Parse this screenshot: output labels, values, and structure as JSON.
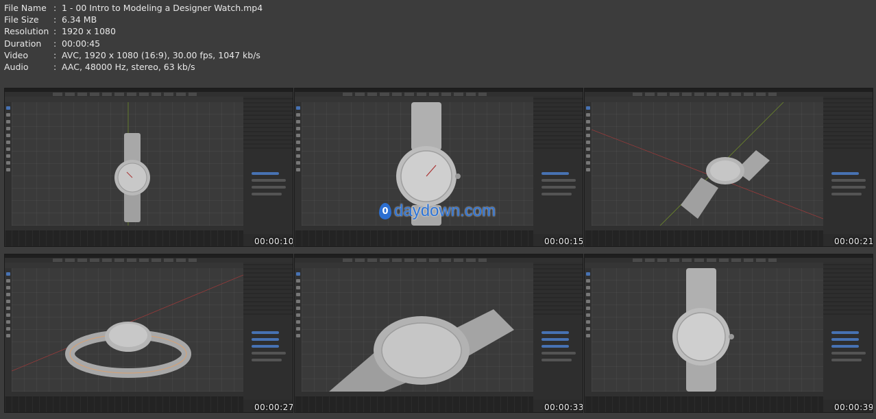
{
  "file_info": [
    {
      "key": "File Name",
      "value": "1 - 00 Intro to Modeling a Designer Watch.mp4"
    },
    {
      "key": "File Size",
      "value": "6.34 MB"
    },
    {
      "key": "Resolution",
      "value": "1920 x 1080"
    },
    {
      "key": "Duration",
      "value": "00:00:45"
    },
    {
      "key": "Video",
      "value": "AVC, 1920 x 1080 (16:9), 30.00 fps, 1047 kb/s"
    },
    {
      "key": "Audio",
      "value": "AAC, 48000 Hz, stereo, 63 kb/s"
    }
  ],
  "separator": ":",
  "thumbnails": [
    {
      "timestamp": "00:00:10",
      "view": "front-small"
    },
    {
      "timestamp": "00:00:15",
      "view": "front-large"
    },
    {
      "timestamp": "00:00:21",
      "view": "perspective"
    },
    {
      "timestamp": "00:00:27",
      "view": "lying-flat"
    },
    {
      "timestamp": "00:00:33",
      "view": "closeup"
    },
    {
      "timestamp": "00:00:39",
      "view": "front-band"
    }
  ],
  "watermark": {
    "text": "daydown.com",
    "color": "#2e74d6"
  },
  "colors": {
    "background": "#3c3c3c",
    "blender_ui": "#2b2b2b",
    "selection": "#4772b3"
  }
}
